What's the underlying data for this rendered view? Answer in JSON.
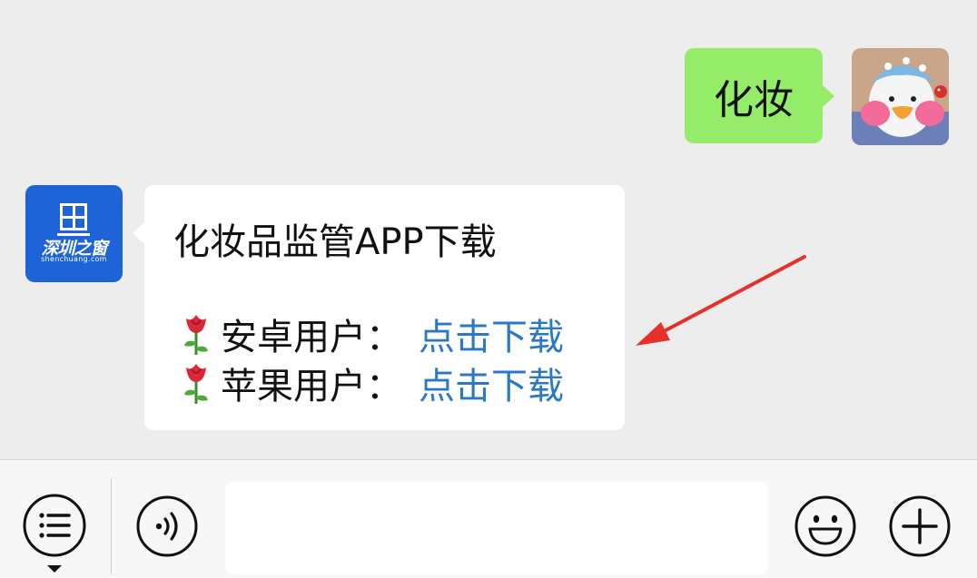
{
  "chat": {
    "outgoing_text": "化妆",
    "incoming": {
      "brand_cn": "深圳之窗",
      "brand_en": "shenchuang.com",
      "title": "化妆品监管APP下载",
      "rows": [
        {
          "label": "安卓用户：",
          "link": "点击下载",
          "icon": "rose-icon"
        },
        {
          "label": "苹果用户：",
          "link": "点击下载",
          "icon": "rose-icon"
        }
      ]
    }
  },
  "input_bar": {
    "icons": [
      "menu-icon",
      "voice-icon",
      "emoji-icon",
      "plus-icon"
    ],
    "text_value": ""
  },
  "colors": {
    "background": "#ededed",
    "outgoing_bubble": "#95ec69",
    "incoming_bubble": "#ffffff",
    "link": "#2a78c6",
    "brand_blue": "#1e63d8",
    "annotation_arrow": "#e8302a"
  }
}
